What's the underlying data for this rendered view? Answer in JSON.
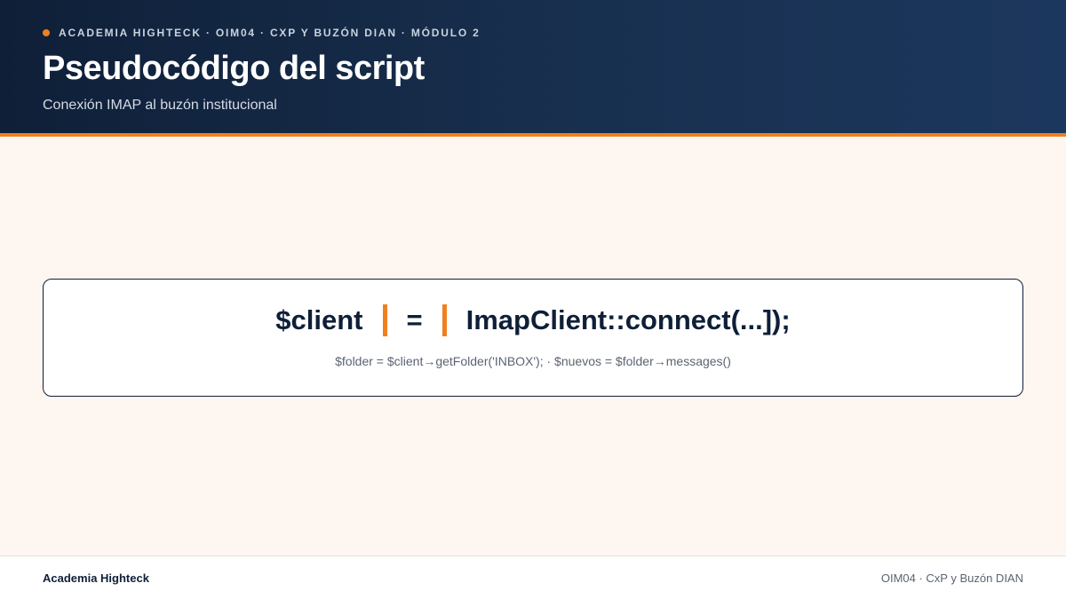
{
  "header": {
    "kicker": "ACADEMIA HIGHTECK · OIM04 · CXP Y BUZÓN DIAN · MÓDULO 2",
    "title": "Pseudocódigo del script",
    "subtitle": "Conexión IMAP al buzón institucional"
  },
  "code": {
    "part1": "$client",
    "part2": "=",
    "part3": "ImapClient::connect(...]);",
    "detail": "$folder = $client→getFolder('INBOX'); · $nuevos = $folder→messages()"
  },
  "footer": {
    "brand": "Academia Highteck",
    "course": "OIM04 · CxP y Buzón DIAN"
  },
  "colors": {
    "navy": "#0f1f38",
    "accent": "#f0801e",
    "background": "#fdf6f1"
  }
}
